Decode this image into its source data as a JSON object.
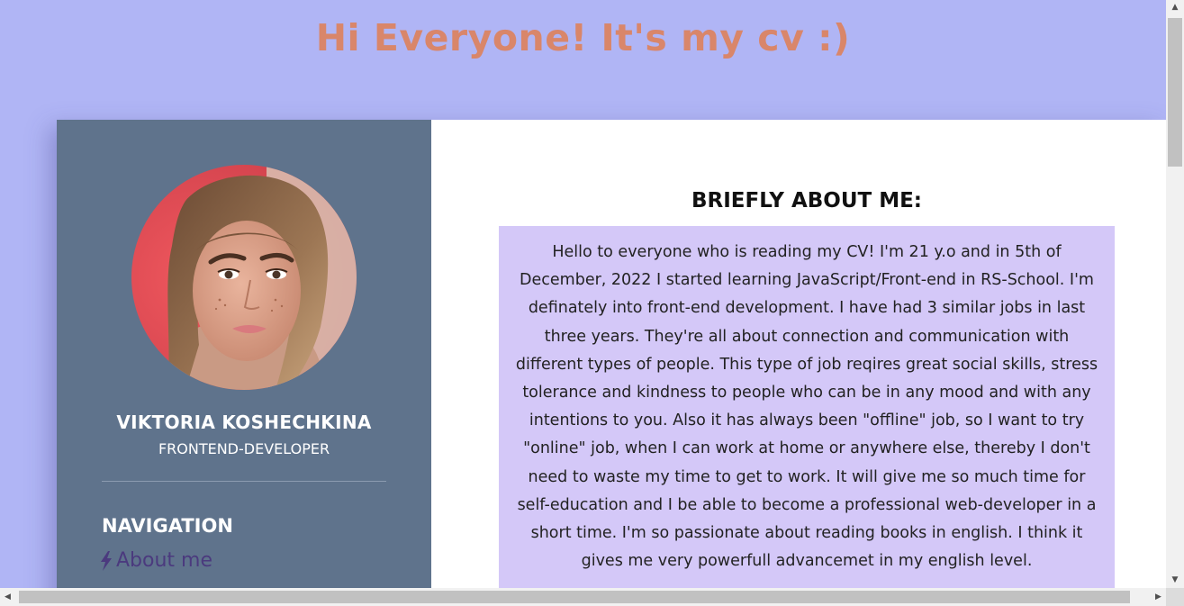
{
  "header": {
    "title": "Hi Everyone! It's my cv :)"
  },
  "profile": {
    "name": "VIKTORIA KOSHECHKINA",
    "role": "FRONTEND-DEVELOPER"
  },
  "navigation": {
    "heading": "NAVIGATION",
    "items": [
      {
        "label": "About me",
        "icon": "lightning-bolt-icon"
      }
    ]
  },
  "about": {
    "heading": "BRIEFLY ABOUT ME:",
    "text": "Hello to everyone who is reading my CV! I'm 21 y.o and in 5th of December, 2022 I started learning JavaScript/Front-end in RS-School. I'm definately into front-end development. I have had 3 similar jobs in last three years. They're all about connection and communication with different types of people. This type of job reqires great social skills, stress tolerance and kindness to people who can be in any mood and with any intentions to you. Also it has always been \"offline\" job, so I want to try \"online\" job, when I can work at home or anywhere else, thereby I don't need to waste my time to get to work. It will give me so much time for self-education and I be able to become a professional web-developer in a short time. I'm so passionate about reading books in english. I think it gives me very powerfull advancemet in my english level."
  },
  "colors": {
    "page_background": "#b0b5f5",
    "title": "#d9866a",
    "sidebar": "#5f738c",
    "about_box": "#d4c8f8",
    "nav_link": "#4b3a7e"
  }
}
